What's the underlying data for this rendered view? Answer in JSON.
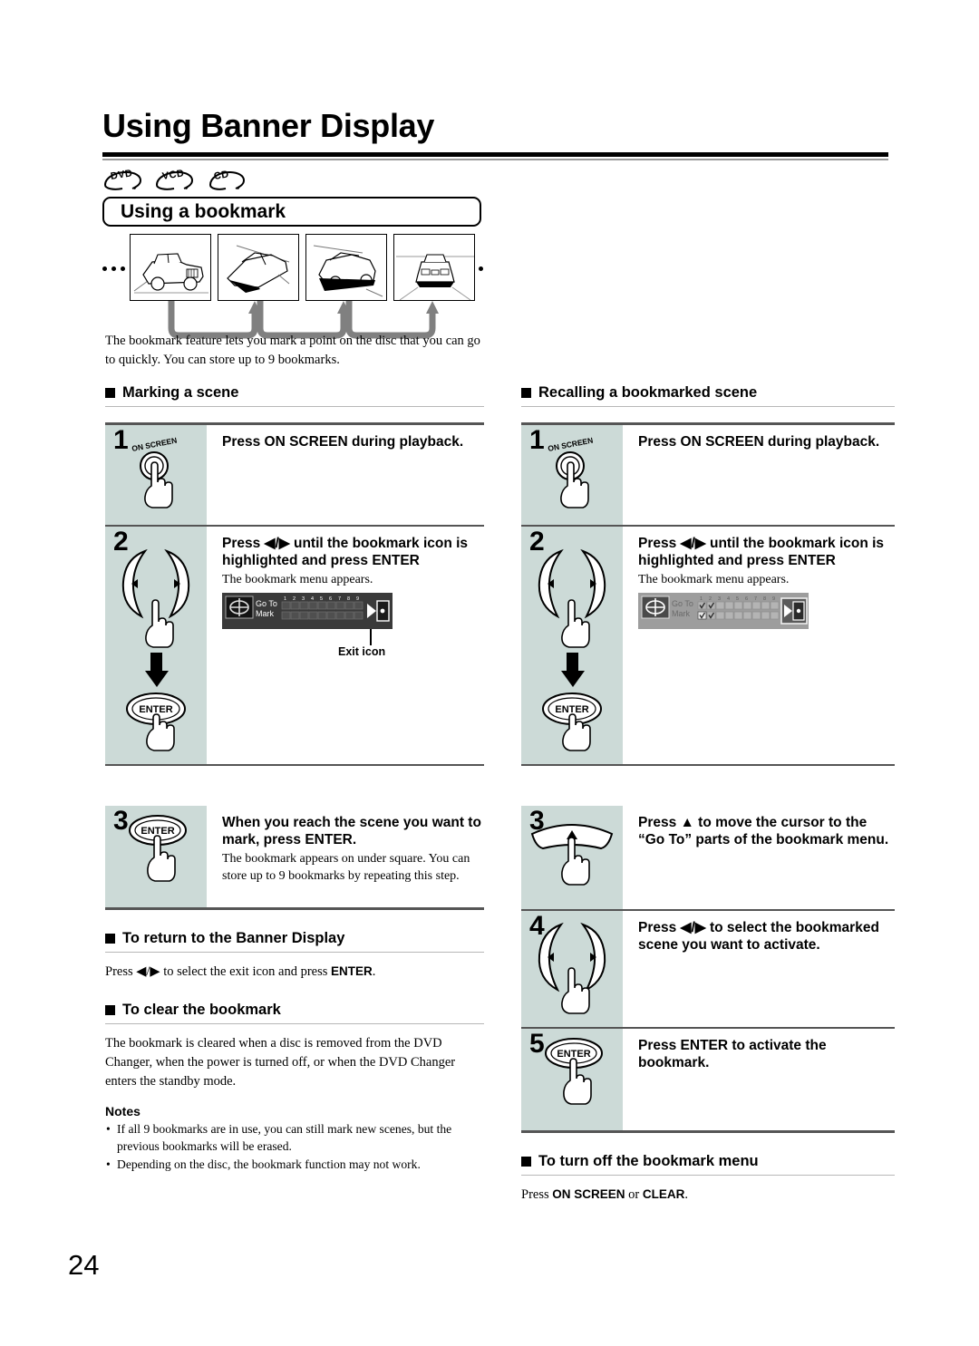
{
  "page": {
    "title": "Using Banner Display",
    "number": "24"
  },
  "disc_badges": [
    {
      "label": "DVD"
    },
    {
      "label": "VCD"
    },
    {
      "label": "CD"
    }
  ],
  "section": {
    "box_title": "Using a bookmark",
    "intro": "The bookmark feature lets you mark a point on the disc that you can go to quickly. You can store up to 9 bookmarks."
  },
  "left_column": {
    "heading": "Marking a scene",
    "steps": [
      {
        "num": "1",
        "art": "on-screen-button",
        "button_label": "ON SCREEN",
        "heading": "Press ON SCREEN during playback.",
        "sub": ""
      },
      {
        "num": "2",
        "art": "left-right-then-enter",
        "button_label": "ENTER",
        "heading": "Press ◀/▶ until the bookmark icon is highlighted and press ENTER",
        "sub": "The bookmark menu appears.",
        "menu": {
          "go_to": "Go To",
          "mark": "Mark",
          "slots": [
            "1",
            "2",
            "3",
            "4",
            "5",
            "6",
            "7",
            "8",
            "9"
          ],
          "checked_go_to": [],
          "checked_mark": [],
          "exit_caption": "Exit icon",
          "style": "dark"
        }
      },
      {
        "num": "3",
        "art": "enter-button",
        "button_label": "ENTER",
        "heading": "When you reach the scene you want to mark, press ENTER.",
        "sub": "The bookmark appears on under square. You can store up to 9 bookmarks by repeating this step."
      }
    ],
    "blocks": [
      {
        "heading": "To return to the Banner Display",
        "body_pre": "Press ◀/▶ to select the exit icon and press ",
        "body_bold": "ENTER",
        "body_post": "."
      },
      {
        "heading": "To clear the bookmark",
        "body_pre": "The bookmark is cleared when a disc is removed from the DVD Changer, when the power is turned off, or when the DVD Changer enters the standby mode.",
        "body_bold": "",
        "body_post": ""
      }
    ],
    "notes_heading": "Notes",
    "notes": [
      "If all 9 bookmarks are in use, you can still mark new scenes, but the previous bookmarks will be erased.",
      "Depending on the disc, the bookmark function may not work."
    ]
  },
  "right_column": {
    "heading": "Recalling a bookmarked scene",
    "steps": [
      {
        "num": "1",
        "art": "on-screen-button",
        "button_label": "ON SCREEN",
        "heading": "Press ON SCREEN during playback.",
        "sub": ""
      },
      {
        "num": "2",
        "art": "left-right-then-enter",
        "button_label": "ENTER",
        "heading": "Press ◀/▶ until the bookmark icon is highlighted and press ENTER",
        "sub": "The bookmark menu appears.",
        "menu": {
          "go_to": "Go To",
          "mark": "Mark",
          "slots": [
            "1",
            "2",
            "3",
            "4",
            "5",
            "6",
            "7",
            "8",
            "9"
          ],
          "checked_go_to": [
            1,
            2
          ],
          "checked_mark": [
            1,
            2
          ],
          "exit_caption": "",
          "style": "light"
        }
      },
      {
        "num": "3",
        "art": "up-arc-button",
        "button_label": "",
        "heading": "Press ▲ to move the cursor to the “Go To” parts of the bookmark menu.",
        "sub": ""
      },
      {
        "num": "4",
        "art": "left-right-buttons",
        "button_label": "",
        "heading": "Press ◀/▶ to select the bookmarked scene you want to activate.",
        "sub": ""
      },
      {
        "num": "5",
        "art": "enter-button",
        "button_label": "ENTER",
        "heading": "Press ENTER to activate the bookmark.",
        "sub": ""
      }
    ],
    "blocks": [
      {
        "heading": "To turn off the bookmark menu",
        "body_pre": "Press ",
        "body_bold": "ON SCREEN",
        "body_mid": " or ",
        "body_bold2": "CLEAR",
        "body_post": "."
      }
    ]
  },
  "colors": {
    "step_cell_bg": "#ccdad7",
    "rule_gray": "#555555",
    "subrule_gray": "#b7b7b7",
    "menu_dark": "#3a3a3a",
    "menu_light": "#9d9d9d"
  }
}
